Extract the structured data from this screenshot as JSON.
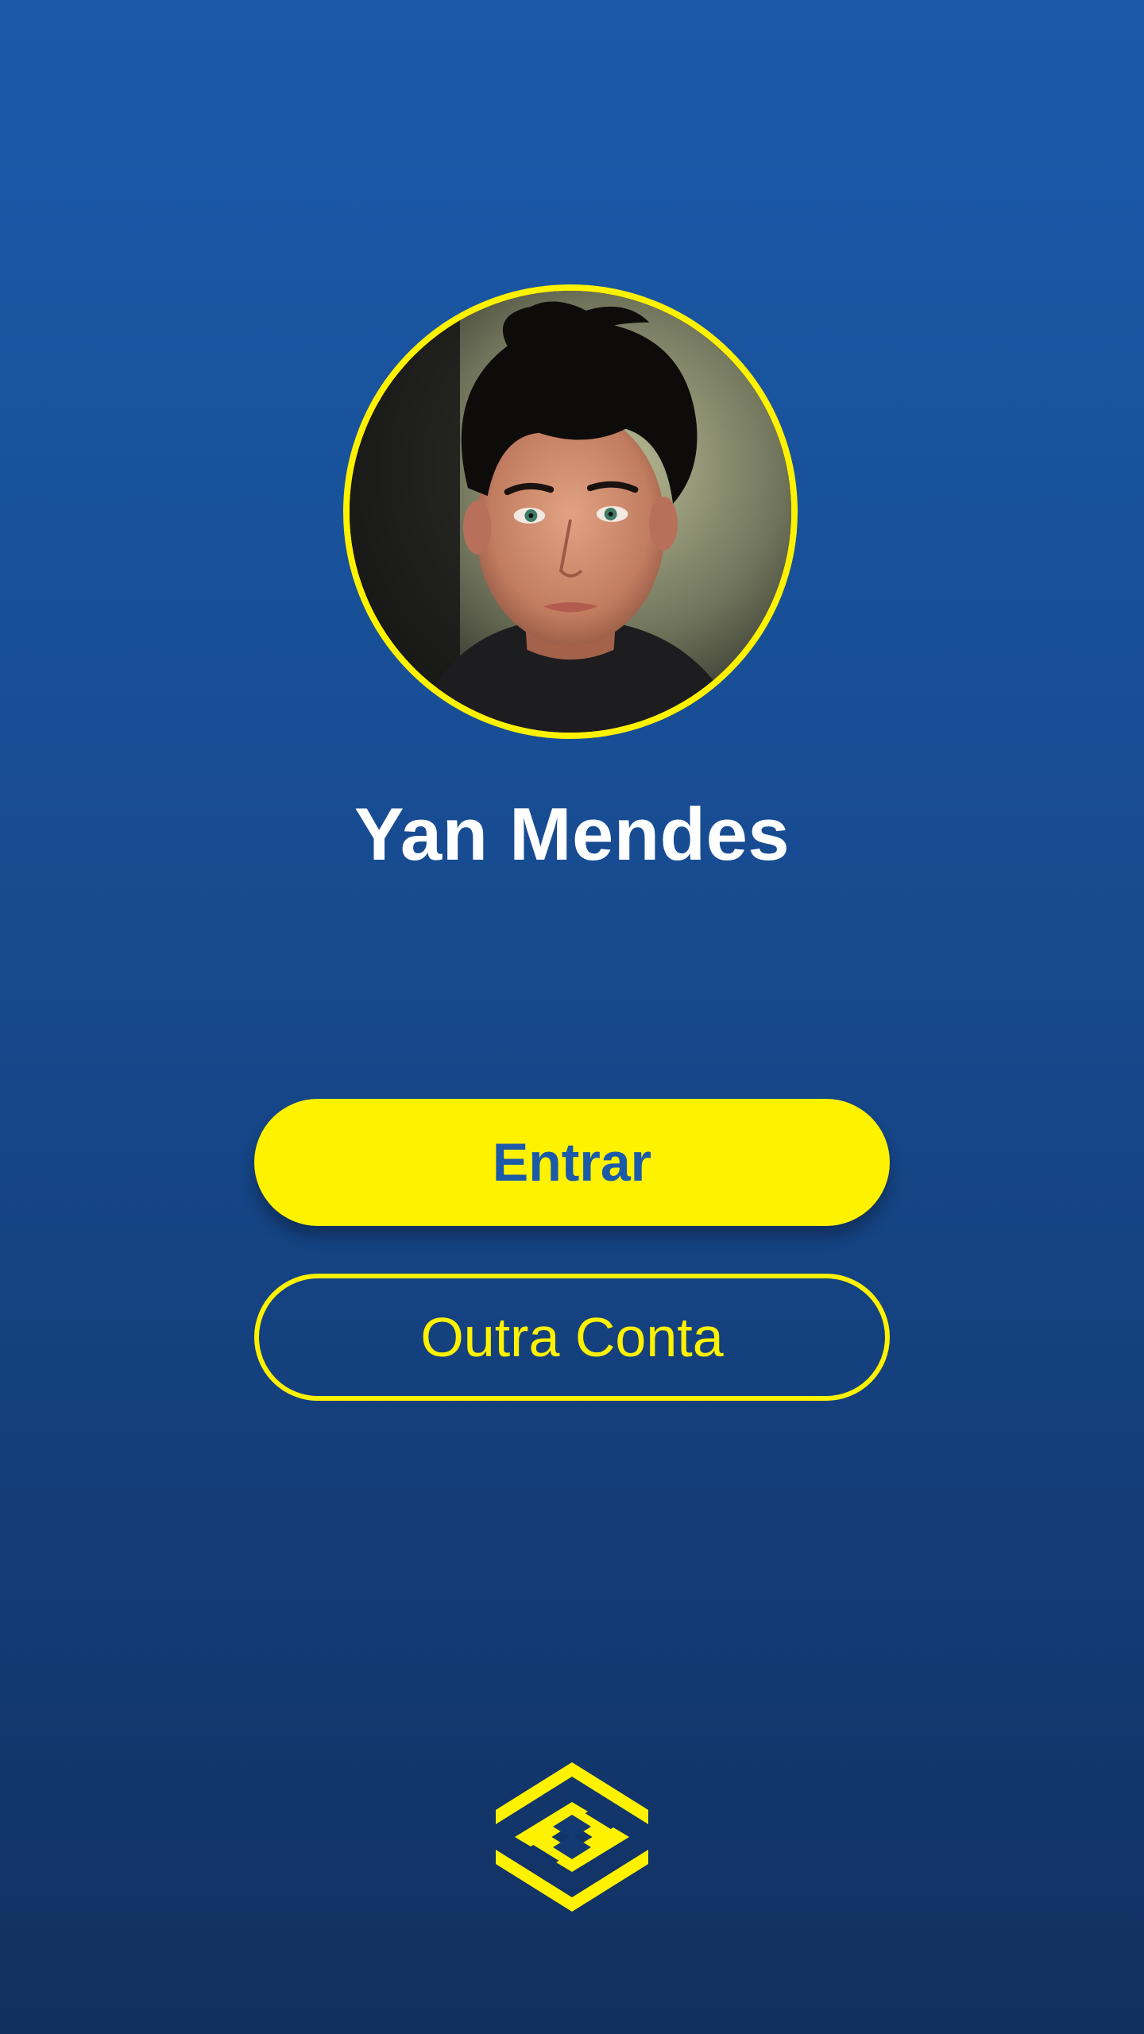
{
  "profile": {
    "name": "Yan Mendes",
    "avatar_icon": "user-avatar-photo"
  },
  "actions": {
    "enter_label": "Entrar",
    "other_account_label": "Outra Conta"
  },
  "brand": {
    "logo_icon": "bank-logo-icon"
  },
  "colors": {
    "accent_yellow": "#fff200",
    "background_top": "#1b5aa9",
    "background_bottom": "#11305f",
    "text_white": "#ffffff"
  }
}
